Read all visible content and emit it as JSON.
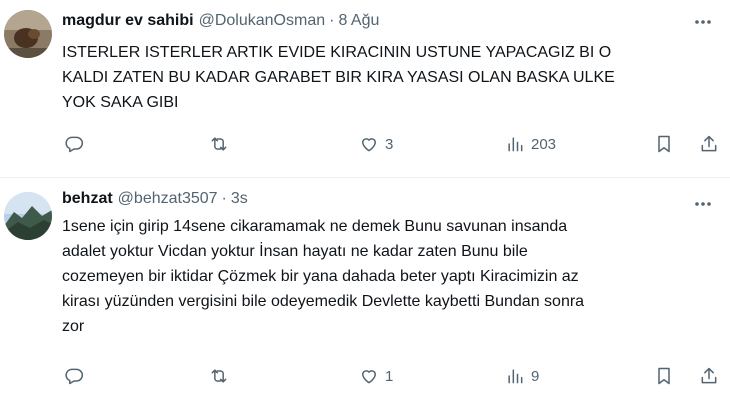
{
  "tweets": [
    {
      "display_name": "magdur ev sahibi",
      "handle": "@DolukanOsman",
      "separator": "·",
      "time": "8 Ağu",
      "text_lines": [
        "ISTERLER ISTERLER ARTIK EVIDE KIRACININ USTUNE YAPACAGIZ BI O",
        "KALDI ZATEN BU KADAR GARABET BIR KIRA YASASI OLAN BASKA ULKE",
        "YOK SAKA GIBI"
      ],
      "stats": {
        "replies": "",
        "retweets": "",
        "likes": "3",
        "views": "203"
      }
    },
    {
      "display_name": "behzat",
      "handle": "@behzat3507",
      "separator": "·",
      "time": "3s",
      "text_lines": [
        "1sene için girip 14sene cikaramamak ne demek Bunu savunan insanda",
        "adalet yoktur Vicdan yoktur İnsan hayatı ne kadar zaten Bunu bile",
        "cozemeyen bir iktidar Çözmek bir yana dahada beter yaptı Kiracimizin az",
        "kirası yüzünden vergisini bile odeyemedik Devlette kaybetti Bundan sonra",
        "zor"
      ],
      "stats": {
        "replies": "",
        "retweets": "",
        "likes": "1",
        "views": "9"
      }
    }
  ],
  "icons": {
    "more": "more-horizontal-icon",
    "reply": "reply-bubble-icon",
    "retweet": "retweet-arrows-icon",
    "like": "heart-icon",
    "views": "bar-chart-icon",
    "bookmark": "bookmark-icon",
    "share": "share-upload-icon"
  },
  "colors": {
    "text_primary": "#0f1419",
    "text_secondary": "#536471",
    "divider": "#eff3f4"
  }
}
